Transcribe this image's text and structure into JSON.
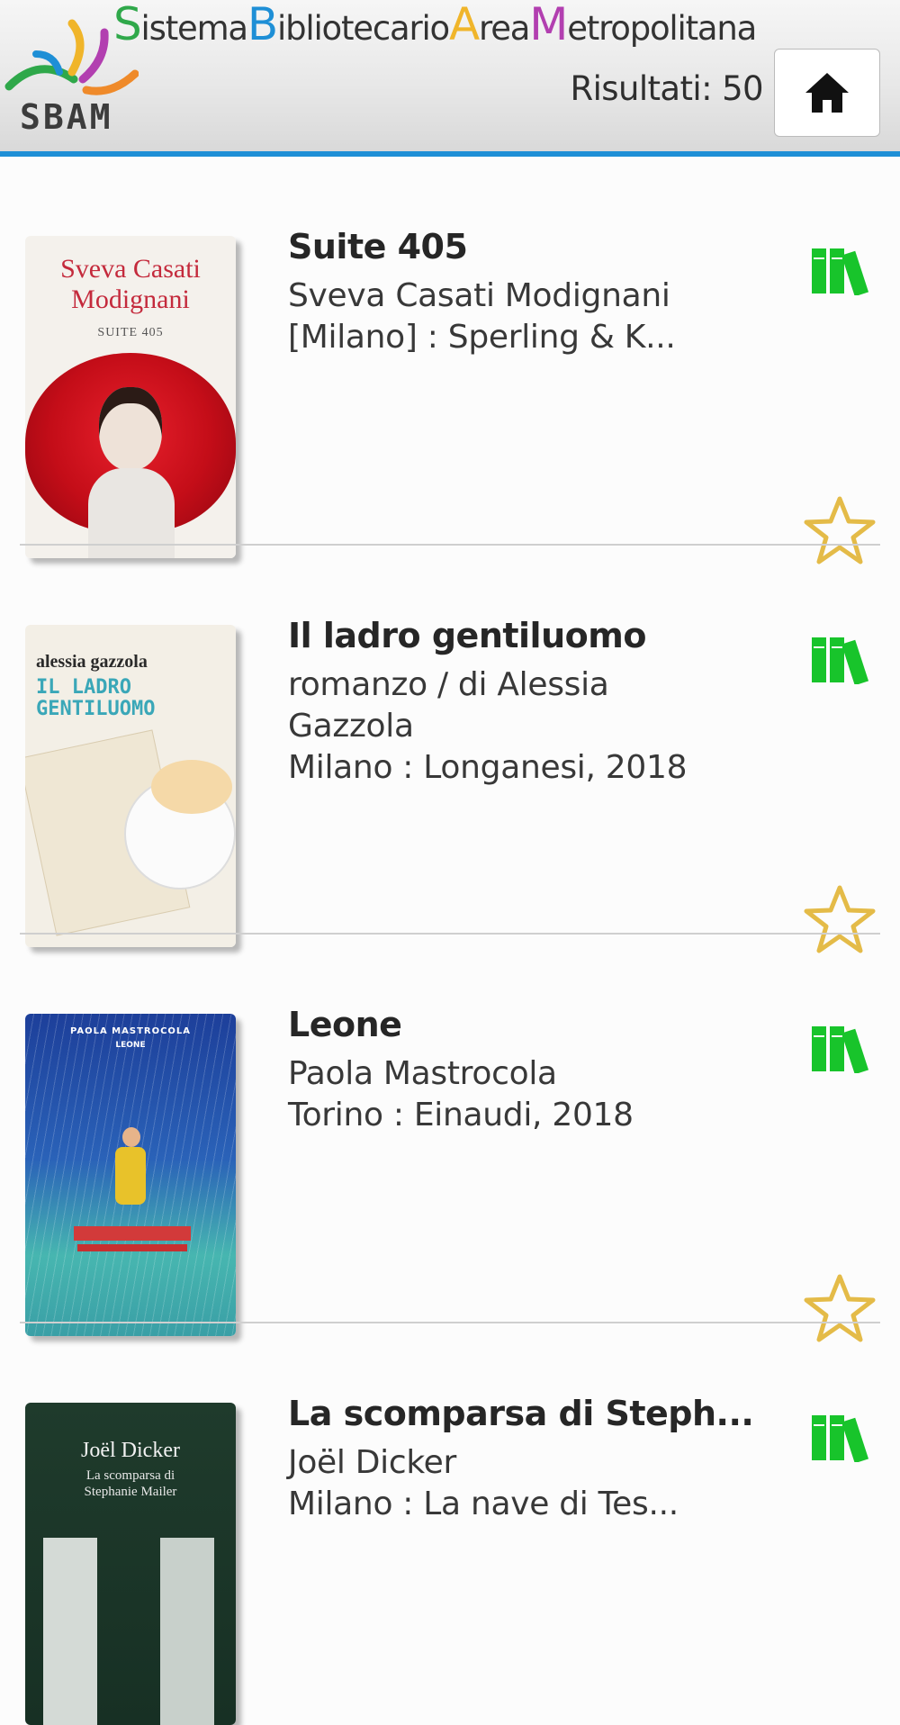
{
  "header": {
    "brand_title_parts": [
      {
        "text": "S",
        "big": true,
        "color": "#2fa84a"
      },
      {
        "text": "istema",
        "big": false,
        "color": "#333333"
      },
      {
        "text": "B",
        "big": true,
        "color": "#1e8fd6"
      },
      {
        "text": "ibliotecario",
        "big": false,
        "color": "#333333"
      },
      {
        "text": "A",
        "big": true,
        "color": "#f0b52a"
      },
      {
        "text": "rea",
        "big": false,
        "color": "#333333"
      },
      {
        "text": "M",
        "big": true,
        "color": "#b23fb0"
      },
      {
        "text": "etropolitana",
        "big": false,
        "color": "#333333"
      }
    ],
    "logo_text": "SBAM",
    "results_label": "Risultati: 50",
    "home_icon": "home-icon",
    "accent_color": "#1e8fd6"
  },
  "results": [
    {
      "title": "Suite 405",
      "lines": [
        "Sveva Casati Modignani",
        "[Milano] : Sperling & K..."
      ],
      "cover": {
        "top_text": "Sveva Casati Modignani",
        "sub_text": "SUITE 405",
        "theme": "rose"
      }
    },
    {
      "title": "Il ladro gentiluomo",
      "lines": [
        "romanzo / di Alessia",
        "Gazzola",
        "Milano : Longanesi, 2018"
      ],
      "cover": {
        "top_text": "alessia gazzola",
        "sub_text": "IL LADRO GENTILUOMO",
        "theme": "letters"
      }
    },
    {
      "title": "Leone",
      "lines": [
        "Paola Mastrocola",
        "Torino : Einaudi, 2018"
      ],
      "cover": {
        "top_text": "PAOLA MASTROCOLA",
        "sub_text": "LEONE",
        "theme": "rain"
      }
    },
    {
      "title": "La scomparsa di Steph...",
      "lines": [
        "Joël Dicker",
        "Milano : La nave di Tes..."
      ],
      "cover": {
        "top_text": "Joël Dicker",
        "sub_text": "La scomparsa di Stephanie Mailer",
        "theme": "dark"
      }
    }
  ],
  "icons": {
    "availability": "books-icon",
    "favorite": "star-outline-icon"
  },
  "colors": {
    "availability_green": "#18c42b",
    "star_gold": "#e4bb48",
    "divider": "#cfcfcf"
  }
}
